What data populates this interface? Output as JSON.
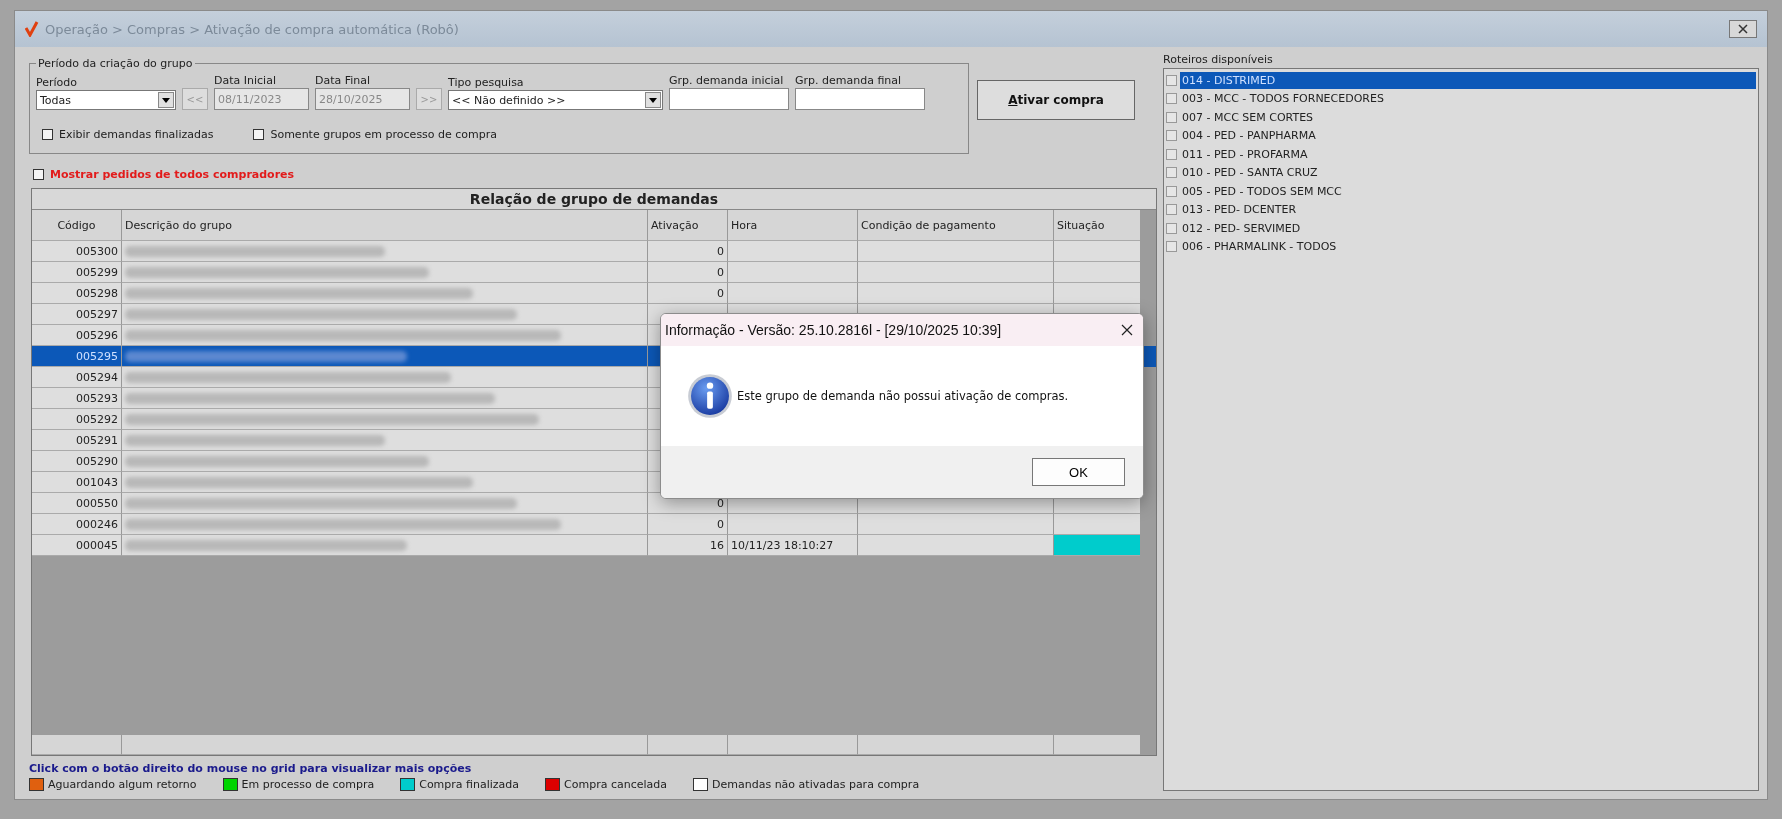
{
  "window": {
    "title": "Operação > Compras > Ativação de compra automática (Robô)"
  },
  "filters": {
    "group_title": "Período da criação do grupo",
    "periodo": {
      "label": "Período",
      "value": "Todas"
    },
    "prev_button": "<<",
    "data_inicial": {
      "label": "Data Inicial",
      "value": "08/11/2023",
      "disabled": true
    },
    "data_final": {
      "label": "Data Final",
      "value": "28/10/2025",
      "disabled": true
    },
    "next_button": ">>",
    "tipo_pesquisa": {
      "label": "Tipo pesquisa",
      "value": "<< Não definido >>"
    },
    "grp_inicial": {
      "label": "Grp. demanda inicial"
    },
    "grp_final": {
      "label": "Grp. demanda final"
    },
    "checkboxes": [
      {
        "label": "Exibir demandas finalizadas",
        "checked": false
      },
      {
        "label": "Somente grupos em processo de compra",
        "checked": false
      }
    ]
  },
  "activate_button": {
    "label": "Ativar compra"
  },
  "show_all": {
    "label": "Mostrar pedidos de todos compradores",
    "checked": false
  },
  "grid": {
    "title": "Relação de grupo de demandas",
    "columns": [
      "Código",
      "Descrição do grupo",
      "Ativação",
      "Hora",
      "Condição de pagamento",
      "Situação"
    ],
    "rows": [
      {
        "codigo": "005300",
        "ativacao": "0",
        "selected": false
      },
      {
        "codigo": "005299",
        "ativacao": "0",
        "selected": false
      },
      {
        "codigo": "005298",
        "ativacao": "0",
        "selected": false
      },
      {
        "codigo": "005297",
        "selected": false
      },
      {
        "codigo": "005296",
        "selected": false
      },
      {
        "codigo": "005295",
        "selected": true
      },
      {
        "codigo": "005294",
        "selected": false
      },
      {
        "codigo": "005293",
        "selected": false
      },
      {
        "codigo": "005292",
        "selected": false
      },
      {
        "codigo": "005291",
        "selected": false
      },
      {
        "codigo": "005290",
        "selected": false
      },
      {
        "codigo": "001043",
        "selected": false
      },
      {
        "codigo": "000550",
        "ativacao": "0",
        "selected": false
      },
      {
        "codigo": "000246",
        "ativacao": "0",
        "selected": false
      },
      {
        "codigo": "000045",
        "ativacao": "16",
        "hora": "10/11/23 18:10:27",
        "color": "#00cccc",
        "selected": false
      }
    ]
  },
  "hint": "Click com o botão direito do mouse no grid para visualizar mais opções",
  "legend": [
    {
      "label": "Aguardando algum retorno",
      "color": "#e0600f"
    },
    {
      "label": "Em processo de compra",
      "color": "#00d400"
    },
    {
      "label": "Compra finalizada",
      "color": "#00cccc"
    },
    {
      "label": "Compra cancelada",
      "color": "#dd0000"
    },
    {
      "label": "Demandas não ativadas para compra",
      "color": "#ffffff"
    }
  ],
  "roteiros": {
    "title": "Roteiros disponíveis",
    "items": [
      {
        "label": "014 - DISTRIMED",
        "checked": false,
        "selected": true
      },
      {
        "label": "003 - MCC - TODOS FORNECEDORES",
        "checked": false,
        "selected": false
      },
      {
        "label": "007 - MCC SEM CORTES",
        "checked": false,
        "selected": false
      },
      {
        "label": "004 - PED - PANPHARMA",
        "checked": false,
        "selected": false
      },
      {
        "label": "011 - PED - PROFARMA",
        "checked": false,
        "selected": false
      },
      {
        "label": "010 - PED - SANTA CRUZ",
        "checked": false,
        "selected": false
      },
      {
        "label": "005 - PED - TODOS SEM MCC",
        "checked": false,
        "selected": false
      },
      {
        "label": "013 - PED- DCENTER",
        "checked": false,
        "selected": false
      },
      {
        "label": "012 - PED- SERVIMED",
        "checked": false,
        "selected": false
      },
      {
        "label": "006 - PHARMALINK - TODOS",
        "checked": false,
        "selected": false
      }
    ]
  },
  "dialog": {
    "title": "Informação - Versão: 25.10.2816l - [29/10/2025 10:39]",
    "message": "Este grupo de demanda não possui ativação de compras.",
    "ok": "OK"
  }
}
